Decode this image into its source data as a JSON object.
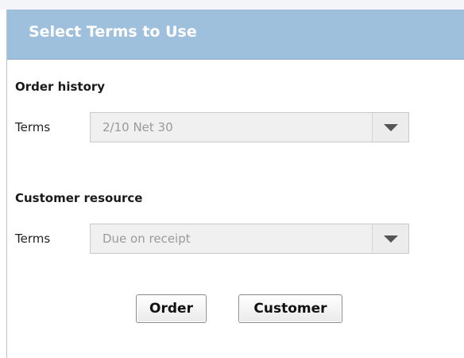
{
  "dialog": {
    "title": "Select Terms to Use"
  },
  "order_history": {
    "heading": "Order history",
    "terms_label": "Terms",
    "terms_value": "2/10 Net 30",
    "dropdown_icon": "chevron-down-icon"
  },
  "customer_resource": {
    "heading": "Customer resource",
    "terms_label": "Terms",
    "terms_value": "Due on receipt",
    "dropdown_icon": "chevron-down-icon"
  },
  "buttons": {
    "order_label": "Order",
    "customer_label": "Customer"
  },
  "colors": {
    "titlebar": "#9fc0dd",
    "title_text": "#ffffff",
    "disabled_text": "#9a9a9a"
  }
}
